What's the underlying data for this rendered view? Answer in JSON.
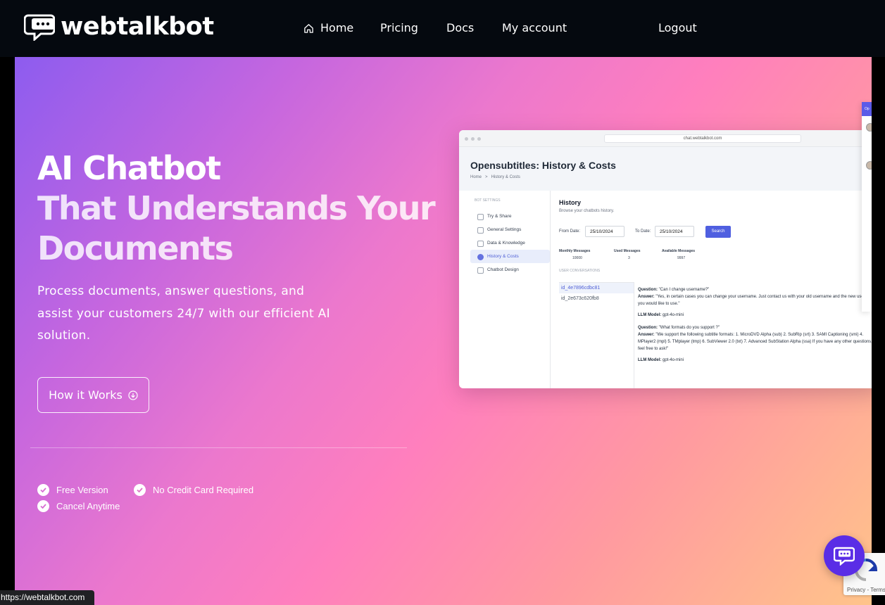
{
  "nav": {
    "brand": "webtalkbot",
    "links": {
      "home": "Home",
      "pricing": "Pricing",
      "docs": "Docs",
      "account": "My account",
      "logout": "Logout"
    }
  },
  "hero": {
    "title_line1": "AI Chatbot",
    "title_line2": "That Understands Your",
    "title_line3": "Documents",
    "description": "Process documents, answer questions, and assist your customers 24/7 with our efficient AI solution.",
    "cta_label": "How it Works",
    "features": [
      "Free Version",
      "No Credit Card Required",
      "Cancel Anytime"
    ]
  },
  "preview": {
    "url": "chat.webtalkbot.com",
    "title": "Opensubtitles: History & Costs",
    "breadcrumb_home": "Home",
    "breadcrumb_sep": ">",
    "breadcrumb_current": "History & Costs",
    "sidebar_heading": "BOT SETTINGS",
    "sidebar_items": [
      "Try & Share",
      "General Settings",
      "Data & Knowledge",
      "History & Costs",
      "Chatbot Design"
    ],
    "history_title": "History",
    "history_sub": "Browse your chatbots history.",
    "from_label": "From Date:",
    "from_value": "25/10/2024",
    "to_label": "To Date:",
    "to_value": "25/10/2024",
    "search_label": "Search",
    "stats": [
      {
        "label": "Monthly Messages",
        "value": "10000"
      },
      {
        "label": "Used Messages",
        "value": "3"
      },
      {
        "label": "Available Messages",
        "value": "9997"
      }
    ],
    "conversations_heading": "USER CONVERSATIONS",
    "conversations": [
      "id_4e7896cdbc81",
      "id_2e673c620fb8"
    ],
    "qa": {
      "q_label": "Question:",
      "a_label": "Answer:",
      "model_label": "LLM Model:",
      "q1": "\"Can I change username?\"",
      "a1": "\"Yes, in certain cases you can change your username. Just contact us with your old username and the new username you would like to use.\"",
      "m1": "gpt-4o-mini",
      "q2": "\"What formats do you support ?\"",
      "a2": "\"We support the following subtitle formats: 1. MicroDVD Alpha (sub) 2. SubRip (srt) 3. SAMI Captioning (smi) 4. MPlayer2 (mpl) 5. TMplayer (tmp) 6. SubViewer 2.0 (txt) 7. Advanced SubStation Alpha (ssa) If you have any other questions, feel free to ask!\"",
      "m2": "gpt-4o-mini"
    },
    "side_tab": "Op"
  },
  "status_bar": "https://webtalkbot.com",
  "recaptcha": "Privacy - Terms",
  "colors": {
    "nav_bg": "#05090f",
    "chat_button": "#5a2de6"
  }
}
